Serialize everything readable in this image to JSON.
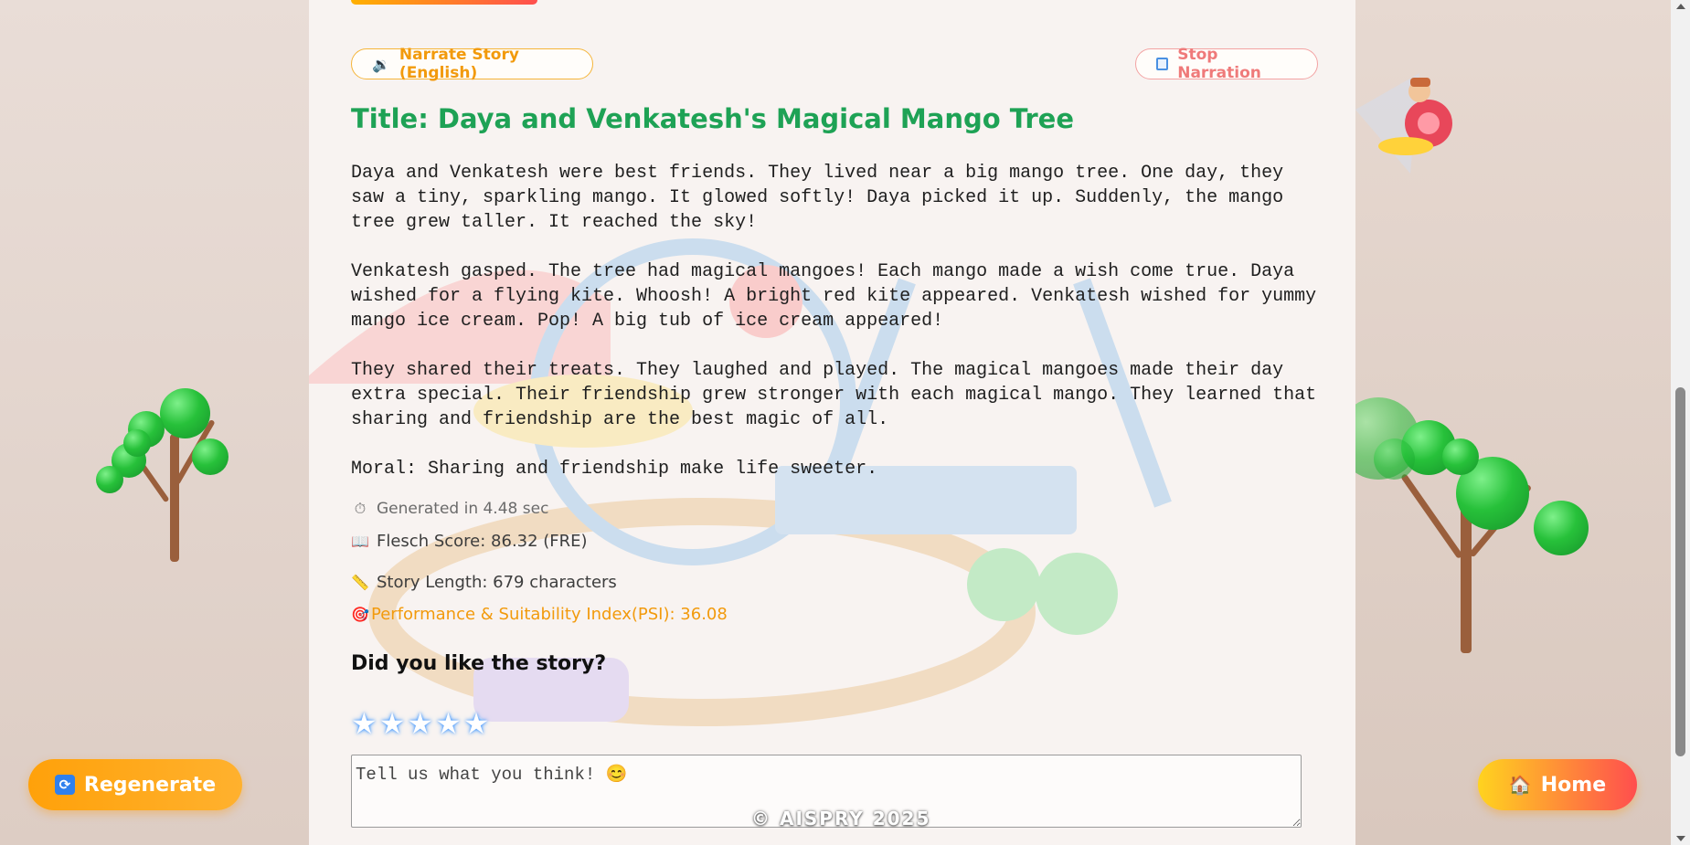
{
  "controls": {
    "narrate_icon": "speaker-icon",
    "narrate_label": "Narrate Story (English)",
    "stop_icon": "stop-icon",
    "stop_label": "Stop Narration"
  },
  "story": {
    "title": "Title: Daya and Venkatesh's Magical Mango Tree",
    "paragraphs": [
      "Daya and Venkatesh were best friends.  They lived near a big mango tree. One day, they saw a tiny, sparkling mango. It glowed softly! Daya picked it up.  Suddenly, the mango tree grew taller.  It reached the sky!",
      "Venkatesh gasped.  The tree had magical mangoes!  Each mango made a wish come true.  Daya wished for a flying kite.  Whoosh!  A bright red kite appeared. Venkatesh wished for yummy mango ice cream.  Pop!  A big tub of ice cream appeared!",
      "They shared their treats. They laughed and played. The magical mangoes made their day extra special.  Their friendship grew stronger with each magical mango. They learned that sharing and friendship are the best magic of all.",
      "Moral: Sharing and friendship make life sweeter."
    ]
  },
  "stats": {
    "generated": "Generated in 4.48 sec",
    "flesch": "Flesch Score: 86.32 (FRE)",
    "length": "Story Length: 679 characters",
    "psi": "Performance & Suitability Index(PSI): 36.08"
  },
  "feedback": {
    "question": "Did you like the story?",
    "stars_total": 5,
    "rating": 0,
    "placeholder": "Tell us what you think! 😊",
    "value": ""
  },
  "footer": {
    "copyright": "© AISPRY 2025"
  },
  "actions": {
    "regenerate_label": "Regenerate",
    "regenerate_icon": "refresh-icon",
    "home_label": "Home",
    "home_icon": "house-icon"
  },
  "colors": {
    "title_green": "#1ea255",
    "accent_orange": "#f29a0c",
    "stop_red": "#ef7a7a"
  }
}
